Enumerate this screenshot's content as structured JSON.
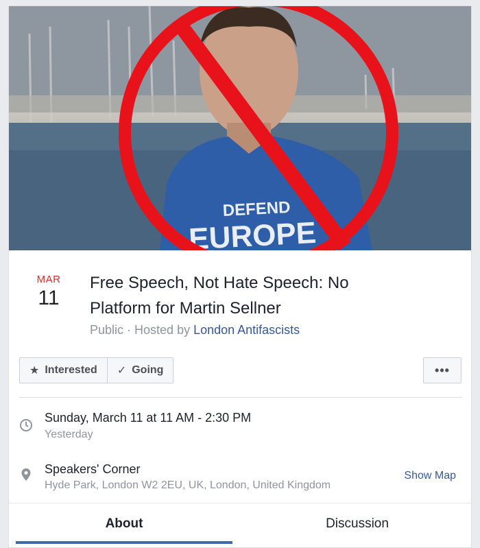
{
  "cover": {
    "shirt_text_top": "DEFEND",
    "shirt_text_bottom": "EUROPE",
    "icons": [
      "prohibition-sign"
    ],
    "colors": {
      "prohibition": "#e8121b",
      "shirt": "#2f5ea8"
    }
  },
  "event": {
    "month": "MAR",
    "day": "11",
    "title": "Free Speech, Not Hate Speech: No Platform for Martin Sellner",
    "privacy": "Public",
    "separator": " · ",
    "hosted_by_prefix": "Hosted by ",
    "host": "London Antifascists"
  },
  "actions": {
    "interested_label": "Interested",
    "going_label": "Going",
    "more_label": "•••"
  },
  "details": {
    "time_main": "Sunday, March 11 at 11 AM - 2:30 PM",
    "time_sub": "Yesterday",
    "place_main": "Speakers' Corner",
    "place_sub": "Hyde Park, London W2 2EU, UK, London, United Kingdom",
    "show_map_label": "Show Map"
  },
  "tabs": [
    {
      "label": "About",
      "active": true
    },
    {
      "label": "Discussion",
      "active": false
    }
  ],
  "colors": {
    "accent": "#4267b2",
    "link": "#365899",
    "date_red": "#e0292d"
  }
}
